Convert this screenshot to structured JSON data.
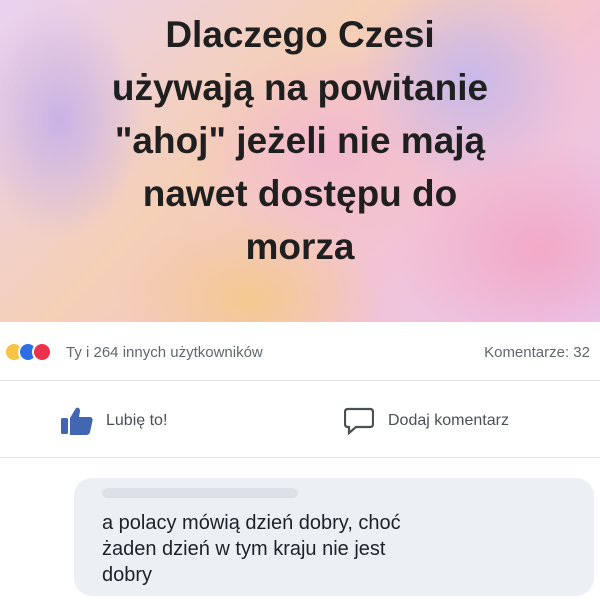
{
  "post": {
    "text": "Dlaczego Czesi\nużywają na powitanie\n\"ahoj\" jeżeli nie mają\nnawet dostępu do\nmorza"
  },
  "reactions": {
    "icons": [
      "haha-icon",
      "wow-icon",
      "love-icon"
    ],
    "summary": "Ty i 264 innych użytkowników",
    "comments_label": "Komentarze: 32"
  },
  "actions": {
    "like_label": "Lubię to!",
    "comment_label": "Dodaj komentarz"
  },
  "comment": {
    "text": "a polacy mówią dzień dobry, choć\nżaden dzień w tym kraju nie jest\ndobry"
  },
  "colors": {
    "accent": "#4267b2",
    "text_secondary": "#606770"
  }
}
